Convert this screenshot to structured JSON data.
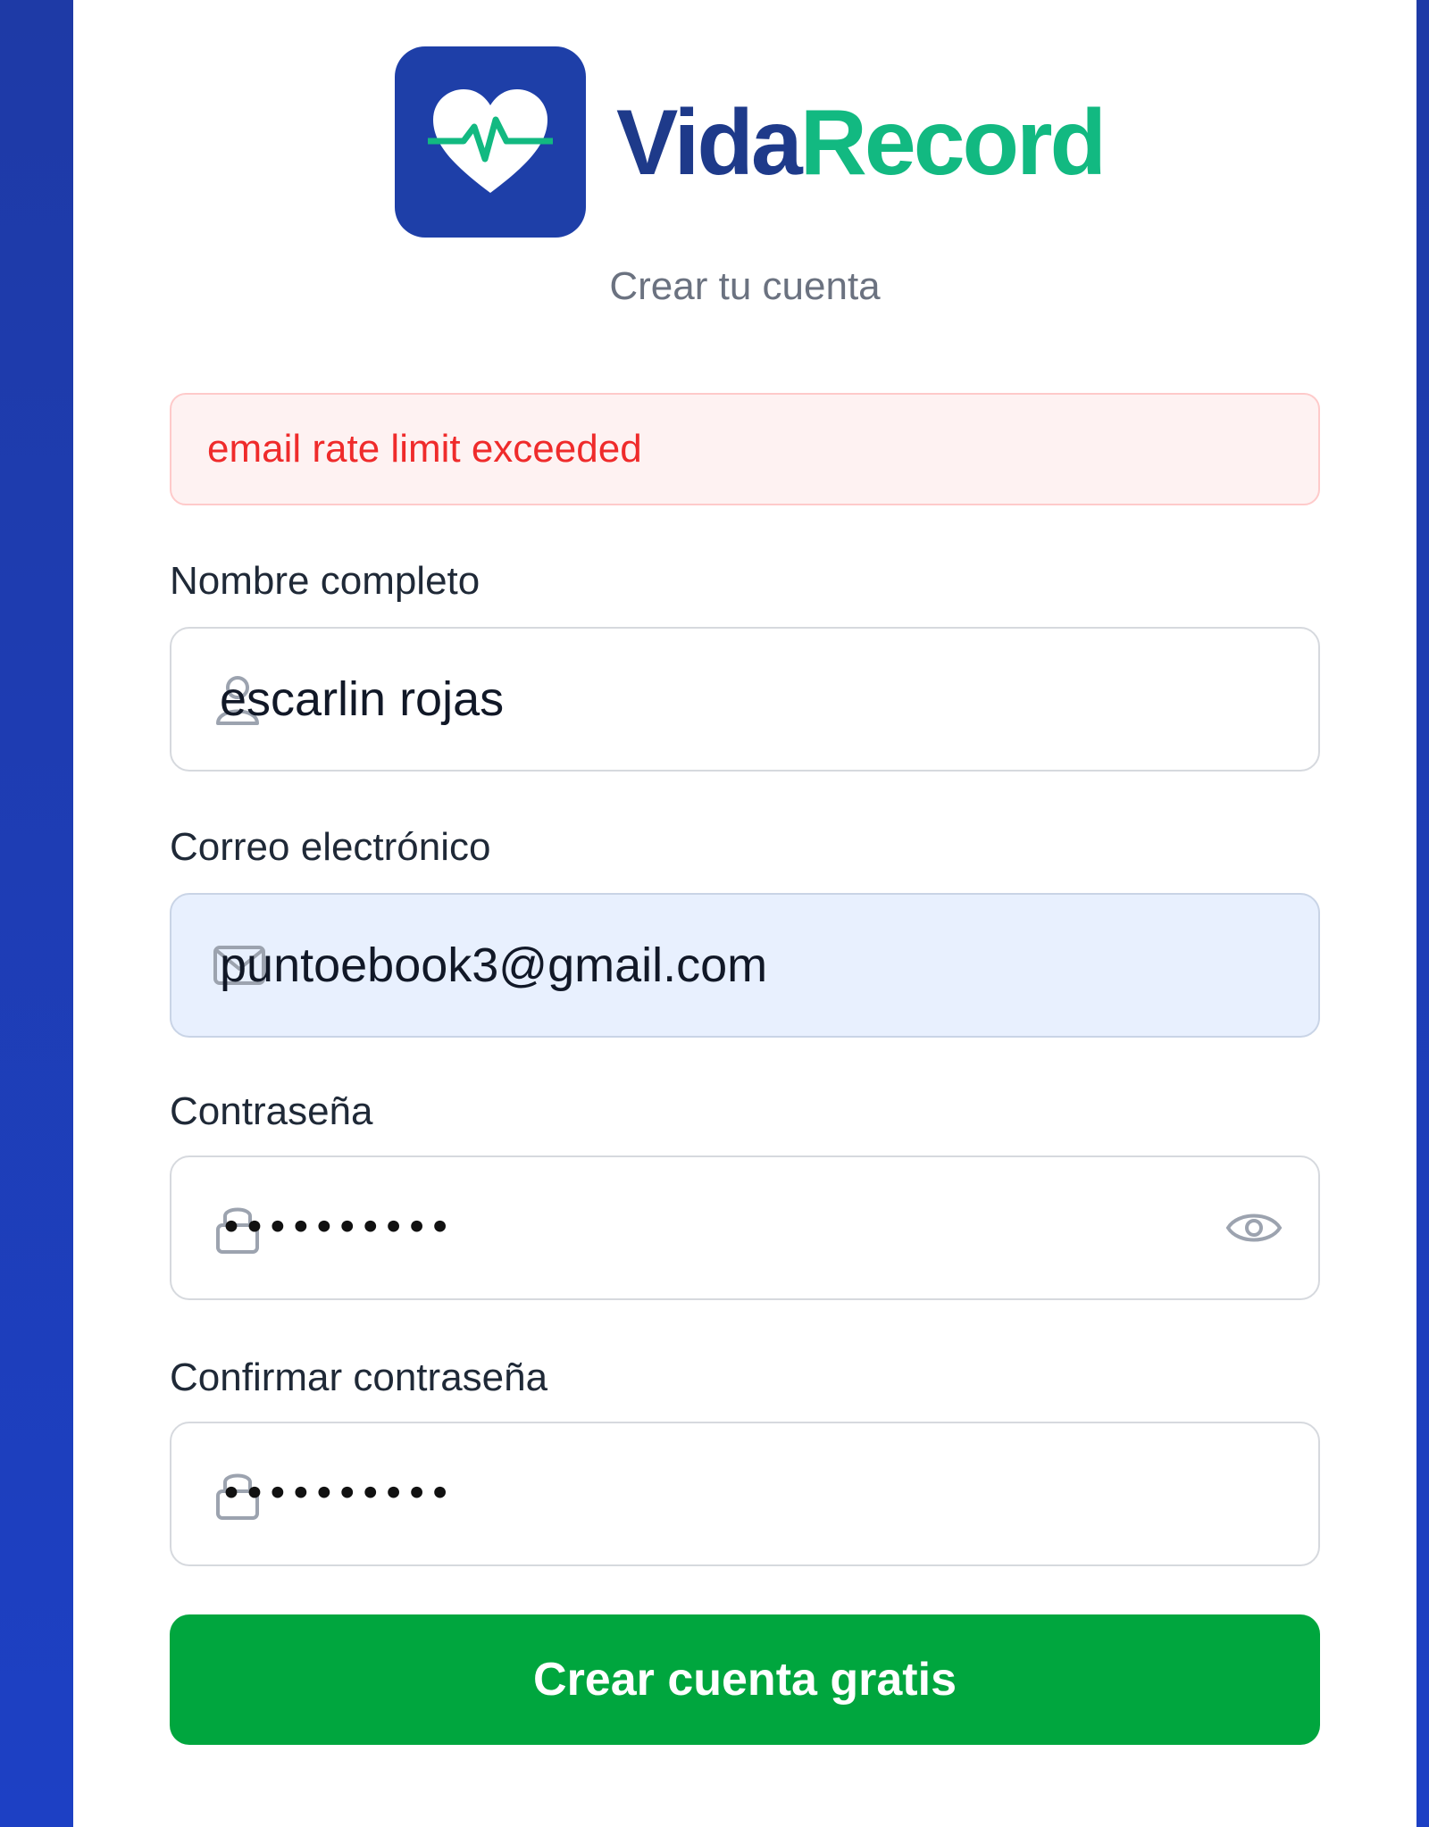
{
  "brand": {
    "name_part1": "Vida",
    "name_part2": "Record",
    "logo_icon": "heart-pulse-icon",
    "colors": {
      "primary": "#1e3fa8",
      "accent": "#12b981"
    }
  },
  "subtitle": "Crear tu cuenta",
  "alert": {
    "message": "email rate limit exceeded",
    "color": "#ef2b2b"
  },
  "form": {
    "full_name": {
      "label": "Nombre completo",
      "value": "escarlin rojas",
      "icon": "user-icon"
    },
    "email": {
      "label": "Correo electrónico",
      "value": "puntoebook3@gmail.com",
      "icon": "mail-icon"
    },
    "password": {
      "label": "Contraseña",
      "value": "••••••••••",
      "icon": "lock-icon",
      "toggle_icon": "eye-icon"
    },
    "confirm_password": {
      "label": "Confirmar contraseña",
      "value": "••••••••••",
      "icon": "lock-icon"
    }
  },
  "submit": {
    "label": "Crear cuenta gratis",
    "color": "#00a63e"
  }
}
